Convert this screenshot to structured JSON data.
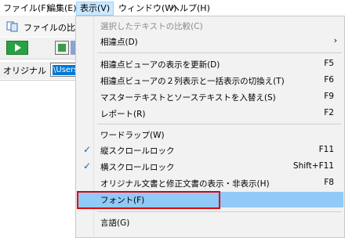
{
  "menubar": {
    "items": [
      {
        "label": "ファイル(F)"
      },
      {
        "label": "編集(E)"
      },
      {
        "label": "表示(V)"
      },
      {
        "label": "ウィンドウ(W)"
      },
      {
        "label": "ヘルプ(H)"
      }
    ]
  },
  "window": {
    "title": "ファイルの比較",
    "original_label": "オリジナル",
    "original_path": "\\Users"
  },
  "view_menu": {
    "items": [
      {
        "label": "選択したテキストの比較(C)",
        "shortcut": "",
        "state": "disabled"
      },
      {
        "label": "相違点(D)",
        "shortcut": "",
        "state": "submenu"
      },
      {
        "label": "相違点ビューアの表示を更新(D)",
        "shortcut": "F5"
      },
      {
        "label": "相違点ビューアの２列表示と一括表示の切換え(T)",
        "shortcut": "F6"
      },
      {
        "label": "マスターテキストとソーステキストを入替え(S)",
        "shortcut": "F9"
      },
      {
        "label": "レポート(R)",
        "shortcut": "F2"
      },
      {
        "label": "ワードラップ(W)",
        "shortcut": ""
      },
      {
        "label": "縦スクロールロック",
        "shortcut": "F11",
        "state": "checked"
      },
      {
        "label": "横スクロールロック",
        "shortcut": "Shift+F11",
        "state": "checked"
      },
      {
        "label": "オリジナル文書と修正文書の表示・非表示(H)",
        "shortcut": "F8"
      },
      {
        "label": "フォント(F)",
        "shortcut": "",
        "state": "highlighted"
      },
      {
        "label": "言語(G)",
        "shortcut": ""
      }
    ]
  },
  "glyphs": {
    "check": "✓",
    "submenu_arrow": "›"
  },
  "colors": {
    "highlight": "#91c9f7",
    "callout_border": "#e0000b",
    "check": "#1a5fb4"
  }
}
